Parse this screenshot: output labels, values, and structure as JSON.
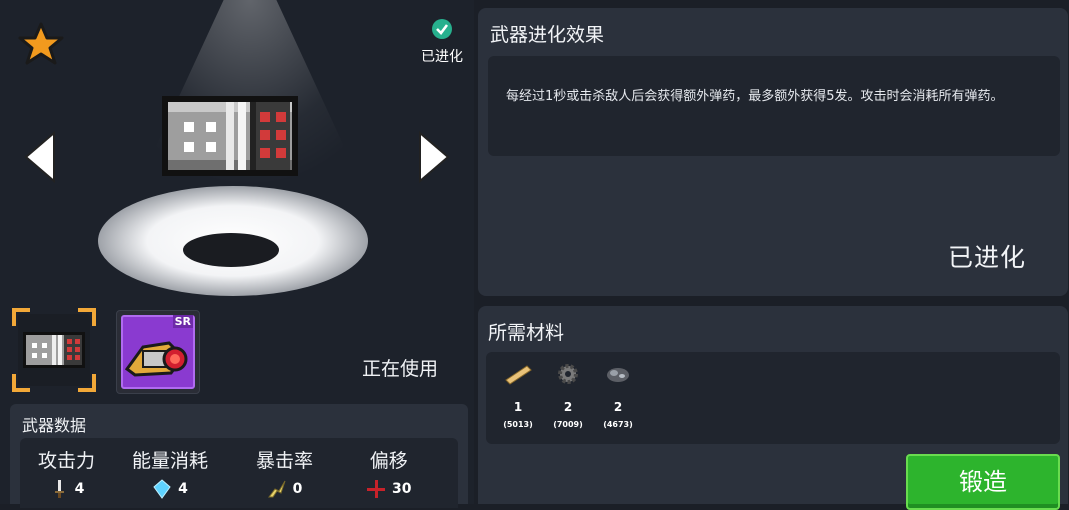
{
  "header": {
    "evolved_badge": "已进化"
  },
  "weapon_slots": {
    "in_use_label": "正在使用",
    "sr_tag": "SR"
  },
  "stats": {
    "title": "武器数据",
    "items": [
      {
        "label": "攻击力",
        "value": "4",
        "icon": "sword-icon"
      },
      {
        "label": "能量消耗",
        "value": "4",
        "icon": "energy-crystal-icon"
      },
      {
        "label": "暴击率",
        "value": "0",
        "icon": "crit-icon"
      },
      {
        "label": "偏移",
        "value": "30",
        "icon": "crosshair-icon"
      }
    ]
  },
  "effect": {
    "title": "武器进化效果",
    "description": "每经过1秒或击杀敌人后会获得额外弹药，最多额外获得5发。攻击时会消耗所有弹药。",
    "status": "已进化"
  },
  "materials": {
    "title": "所需材料",
    "items": [
      {
        "icon": "wood-plank-icon",
        "qty": "1",
        "owned": "(5013)"
      },
      {
        "icon": "gear-part-icon",
        "qty": "2",
        "owned": "(7009)"
      },
      {
        "icon": "ore-icon",
        "qty": "2",
        "owned": "(4673)"
      }
    ],
    "forge_label": "锻造"
  },
  "colors": {
    "accent_green": "#2db42d",
    "accent_orange": "#f2a838",
    "sr_purple": "#8a3ad0"
  }
}
